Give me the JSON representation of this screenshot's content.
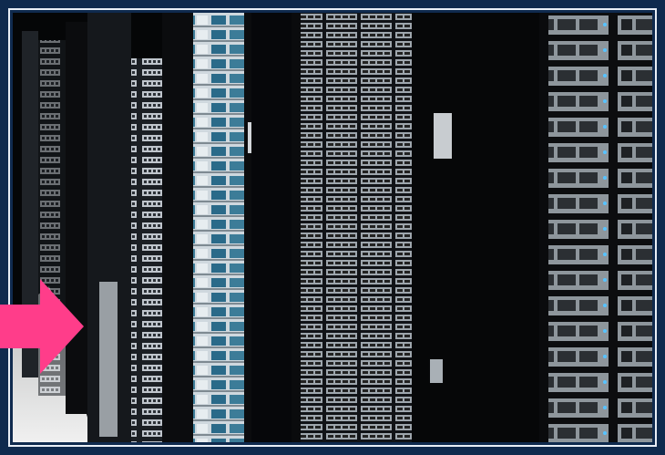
{
  "image": {
    "subject": "server racks",
    "colors": {
      "background": "#0f2a4e",
      "frame": "#e9eef6",
      "arrow": "#ff3d8a",
      "rack_dark": "#0b0c0e",
      "rack_light": "#1d2126",
      "server_panel": "#d8dde3",
      "server_blue": "#2a6a89",
      "floor": "#e6e7e7"
    },
    "icons": [
      "arrow-pointer-icon"
    ]
  }
}
